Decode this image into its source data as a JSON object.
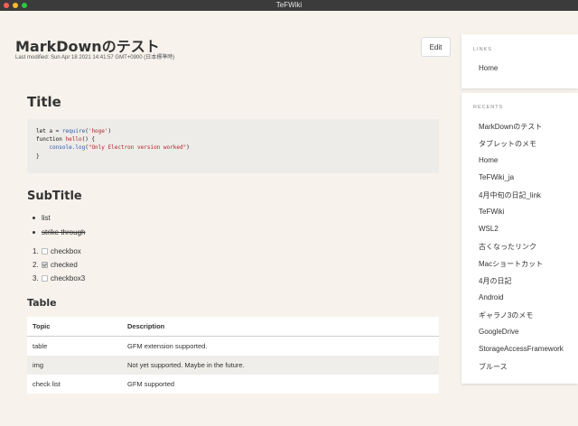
{
  "window": {
    "title": "TeFWiki"
  },
  "page": {
    "title": "MarkDownのテスト",
    "modified": "Last modified: Sun Apr 18 2021 14:41:57 GMT+0900 (日本標準時)",
    "edit_label": "Edit"
  },
  "doc": {
    "h1": "Title",
    "code": {
      "line1_kw": "let",
      "line1_a": " a = ",
      "line1_req": "require",
      "line1_p1": "(",
      "line1_str": "'hoge'",
      "line1_p2": ")",
      "line2_kw": "function",
      "line2_sp": " ",
      "line2_fn": "hello",
      "line2_rest": "() {",
      "line3_indent": "    ",
      "line3_log": "console.log",
      "line3_p1": "(",
      "line3_str": "\"Only Electron version worked\"",
      "line3_p2": ")",
      "line4": "}"
    },
    "h2": "SubTitle",
    "list": [
      "list",
      "strike through"
    ],
    "tasks": [
      {
        "num": "1.",
        "label": "checkbox",
        "checked": false
      },
      {
        "num": "2.",
        "label": "checked",
        "checked": true
      },
      {
        "num": "3.",
        "label": "checkbox3",
        "checked": false
      }
    ],
    "h3": "Table",
    "table": {
      "headers": [
        "Topic",
        "Description"
      ],
      "rows": [
        [
          "table",
          "GFM extension supported."
        ],
        [
          "img",
          "Not yet supported. Maybe in the future."
        ],
        [
          "check list",
          "GFM supported"
        ]
      ]
    }
  },
  "sidebar": {
    "links_title": "LINKS",
    "links": [
      "Home"
    ],
    "recents_title": "RECENTS",
    "recents": [
      "MarkDownのテスト",
      "タブレットのメモ",
      "Home",
      "TeFWiki_ja",
      "4月中旬の日記_link",
      "TeFWiki",
      "WSL2",
      "古くなったリンク",
      "Macショートカット",
      "4月の日記",
      "Android",
      "ギャラノ3のメモ",
      "GoogleDrive",
      "StorageAccessFramework",
      "ブルース"
    ]
  }
}
